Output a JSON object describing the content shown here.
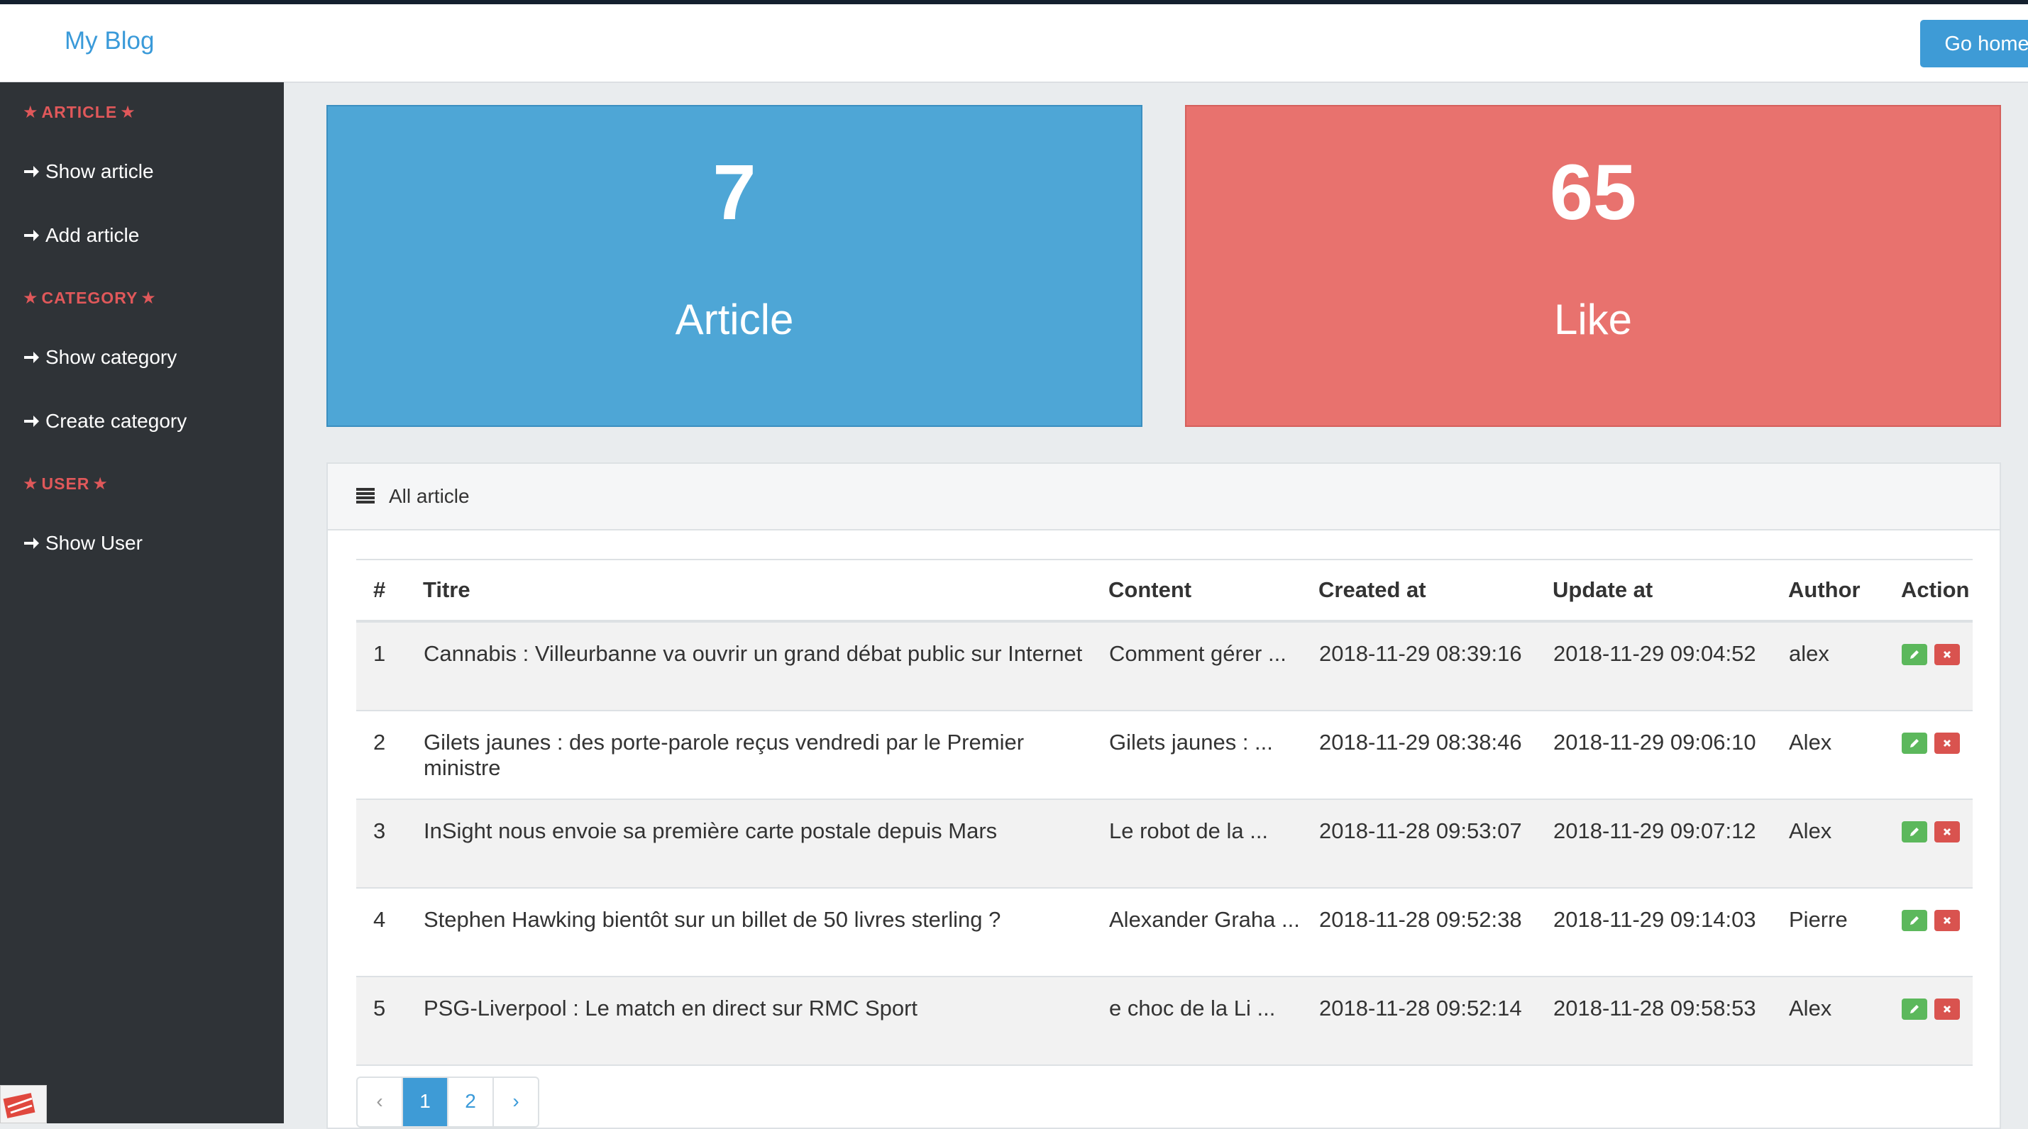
{
  "navbar": {
    "brand": "My Blog",
    "go_home": "Go home"
  },
  "sidebar": {
    "sections": [
      {
        "heading": "ARTICLE",
        "links": [
          "Show article",
          "Add article"
        ]
      },
      {
        "heading": "CATEGORY",
        "links": [
          "Show category",
          "Create category"
        ]
      },
      {
        "heading": "USER",
        "links": [
          "Show User"
        ]
      }
    ]
  },
  "stats": {
    "articles": {
      "value": "7",
      "label": "Article",
      "color": "#4ea6d6"
    },
    "likes": {
      "value": "65",
      "label": "Like",
      "color": "#e8726e"
    }
  },
  "panel": {
    "title": "All article",
    "icon": "list-icon"
  },
  "table": {
    "headers": [
      "#",
      "Titre",
      "Content",
      "Created at",
      "Update at",
      "Author",
      "Action"
    ],
    "rows": [
      {
        "id": "1",
        "title": "Cannabis : Villeurbanne va ouvrir un grand débat public sur Internet",
        "content": "Comment gérer ...",
        "created": "2018-11-29 08:39:16",
        "updated": "2018-11-29 09:04:52",
        "author": "alex"
      },
      {
        "id": "2",
        "title": "Gilets jaunes : des porte-parole reçus vendredi par le Premier ministre",
        "content": "Gilets jaunes : ...",
        "created": "2018-11-29 08:38:46",
        "updated": "2018-11-29 09:06:10",
        "author": "Alex"
      },
      {
        "id": "3",
        "title": "InSight nous envoie sa première carte postale depuis Mars",
        "content": "Le robot de la ...",
        "created": "2018-11-28 09:53:07",
        "updated": "2018-11-29 09:07:12",
        "author": "Alex"
      },
      {
        "id": "4",
        "title": "Stephen Hawking bientôt sur un billet de 50 livres sterling ?",
        "content": "Alexander Graha ...",
        "created": "2018-11-28 09:52:38",
        "updated": "2018-11-29 09:14:03",
        "author": "Pierre"
      },
      {
        "id": "5",
        "title": "PSG-Liverpool : Le match en direct sur RMC Sport",
        "content": "e choc de la Li ...",
        "created": "2018-11-28 09:52:14",
        "updated": "2018-11-28 09:58:53",
        "author": "Alex"
      }
    ]
  },
  "pagination": {
    "prev": "‹",
    "pages": [
      "1",
      "2"
    ],
    "active": "1",
    "next": "›"
  }
}
